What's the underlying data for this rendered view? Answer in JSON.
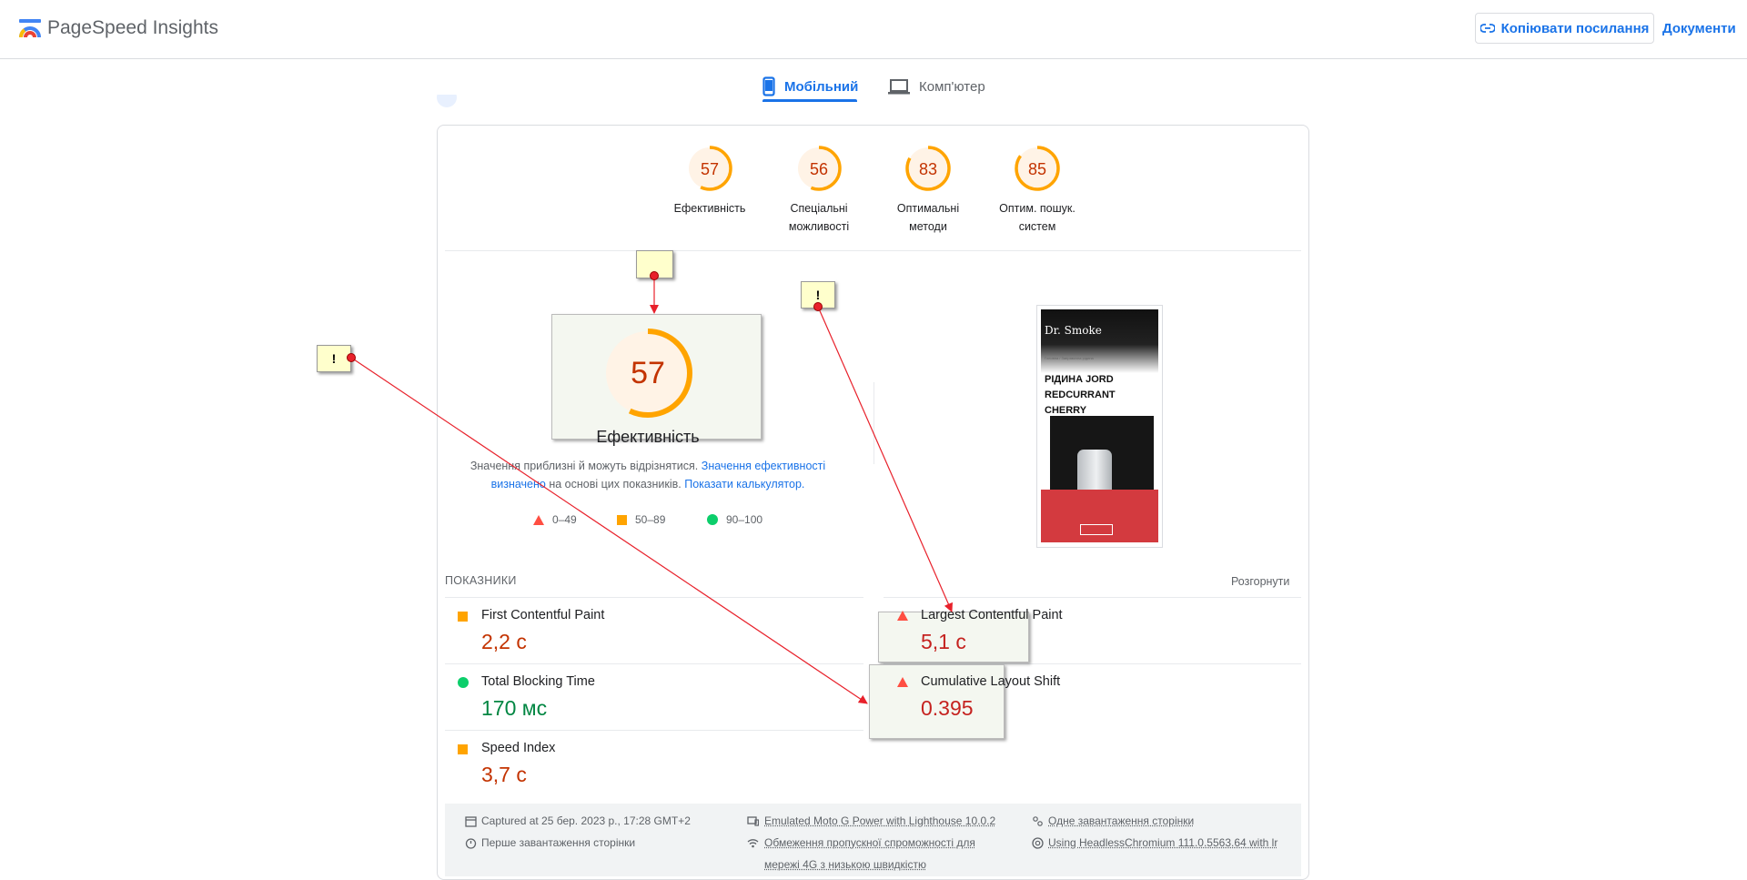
{
  "header": {
    "app_title": "PageSpeed Insights",
    "copy_link_label": "Копіювати посилання",
    "docs_label": "Документи",
    "brand_colors": [
      "#4285f4",
      "#ea4335",
      "#fbbc04",
      "#34a853"
    ]
  },
  "tabs": [
    {
      "label": "Мобільний",
      "icon": "phone-icon",
      "active": true
    },
    {
      "label": "Комп'ютер",
      "icon": "laptop-icon",
      "active": false
    }
  ],
  "categories": [
    {
      "score": "57",
      "label_lines": [
        "Ефективність"
      ],
      "fraction": 0.57
    },
    {
      "score": "56",
      "label_lines": [
        "Спеціальні",
        "можливості"
      ],
      "fraction": 0.56
    },
    {
      "score": "83",
      "label_lines": [
        "Оптимальні",
        "методи"
      ],
      "fraction": 0.83
    },
    {
      "score": "85",
      "label_lines": [
        "Оптим. пошук.",
        "систем"
      ],
      "fraction": 0.85
    }
  ],
  "performance": {
    "score": "57",
    "fraction": 0.57,
    "title": "Ефективність",
    "disclaimer_text_1": "Значення приблизні й можуть відрізнятися. ",
    "disclaimer_link_1": "Значення ефективності визначено",
    "disclaimer_text_2": " на основі цих показників. ",
    "disclaimer_link_2": "Показати калькулятор."
  },
  "legend": [
    {
      "range": "0–49",
      "shape": "triangle",
      "color": "#ff4e42"
    },
    {
      "range": "50–89",
      "shape": "square",
      "color": "#ffa400"
    },
    {
      "range": "90–100",
      "shape": "circle",
      "color": "#0cce6b"
    }
  ],
  "screenshot": {
    "logo_text": "Dr. Smoke",
    "crumbs": "Головна / Заправочна рідина",
    "heading": "РІДИНА JORD REDCURRANT CHERRY",
    "banner_button": "Прийняти"
  },
  "metrics": {
    "header": "ПОКАЗНИКИ",
    "expand_label": "Розгорнути",
    "items": [
      {
        "name": "First Contentful Paint",
        "value": "2,2 с",
        "status": "average"
      },
      {
        "name": "Largest Contentful Paint",
        "value": "5,1 с",
        "status": "fail"
      },
      {
        "name": "Total Blocking Time",
        "value": "170 мс",
        "status": "pass"
      },
      {
        "name": "Cumulative Layout Shift",
        "value": "0.395",
        "status": "fail"
      },
      {
        "name": "Speed Index",
        "value": "3,7 с",
        "status": "average"
      }
    ]
  },
  "footer": {
    "captured": "Captured at 25 бер. 2023 р., 17:28 GMT+2",
    "first_load": "Перше завантаження сторінки",
    "emulated": "Emulated Moto G Power with Lighthouse 10.0.2",
    "throttling": "Обмеження пропускної спроможності для мережі 4G з низькою швидкістю",
    "single_load": "Одне завантаження сторінки",
    "browser": "Using HeadlessChromium 111.0.5563.64 with lr"
  },
  "annotations": [
    {
      "text": ""
    },
    {
      "text": "!"
    },
    {
      "text": "!"
    }
  ]
}
